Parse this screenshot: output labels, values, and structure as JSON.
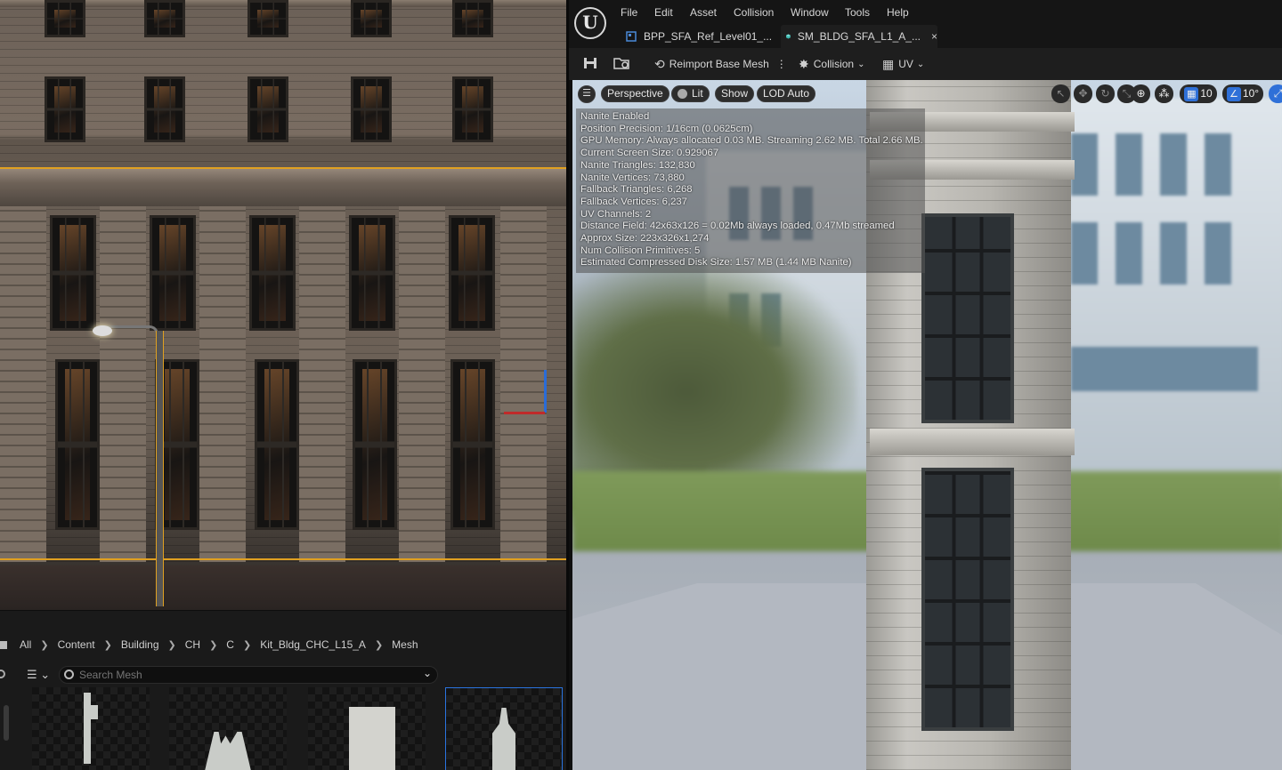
{
  "left_viewport": {
    "description": ""
  },
  "content_browser": {
    "breadcrumb": [
      "All",
      "Content",
      "Building",
      "CH",
      "C",
      "Kit_Bldg_CHC_L15_A",
      "Mesh"
    ],
    "search": {
      "placeholder": "Search Mesh",
      "value": ""
    }
  },
  "menu": {
    "items": [
      "File",
      "Edit",
      "Asset",
      "Collision",
      "Window",
      "Tools",
      "Help"
    ]
  },
  "tabs": [
    {
      "label": "BPP_SFA_Ref_Level01_...",
      "icon": "level-icon"
    },
    {
      "label": "SM_BLDG_SFA_L1_A_...",
      "icon": "static-mesh-icon",
      "close": "×"
    }
  ],
  "toolbar": {
    "reimport_label": "Reimport Base Mesh",
    "collision_label": "Collision",
    "uv_label": "UV"
  },
  "viewport": {
    "perspective_label": "Perspective",
    "lit_label": "Lit",
    "show_label": "Show",
    "lod_label": "LOD Auto",
    "grid_snap_value": "10",
    "rotation_snap_value": "10°"
  },
  "stats": [
    "Nanite Enabled",
    "Position Precision: 1/16cm (0.0625cm)",
    "GPU Memory: Always allocated 0.03 MB. Streaming 2.62 MB. Total 2.66 MB.",
    "Current Screen Size: 0.929067",
    "Nanite Triangles: 132,830",
    "Nanite Vertices: 73,880",
    "Fallback Triangles: 6,268",
    "Fallback Vertices: 6,237",
    "UV Channels: 2",
    "Distance Field: 42x63x126 = 0.02Mb always loaded, 0.47Mb streamed",
    "Approx Size: 223x326x1,274",
    "Num Collision Primitives: 5",
    "Estimated Compressed Disk Size: 1.57 MB (1.44 MB Nanite)"
  ],
  "colors": {
    "accent": "#2f70d8",
    "selection": "#e0a020"
  }
}
